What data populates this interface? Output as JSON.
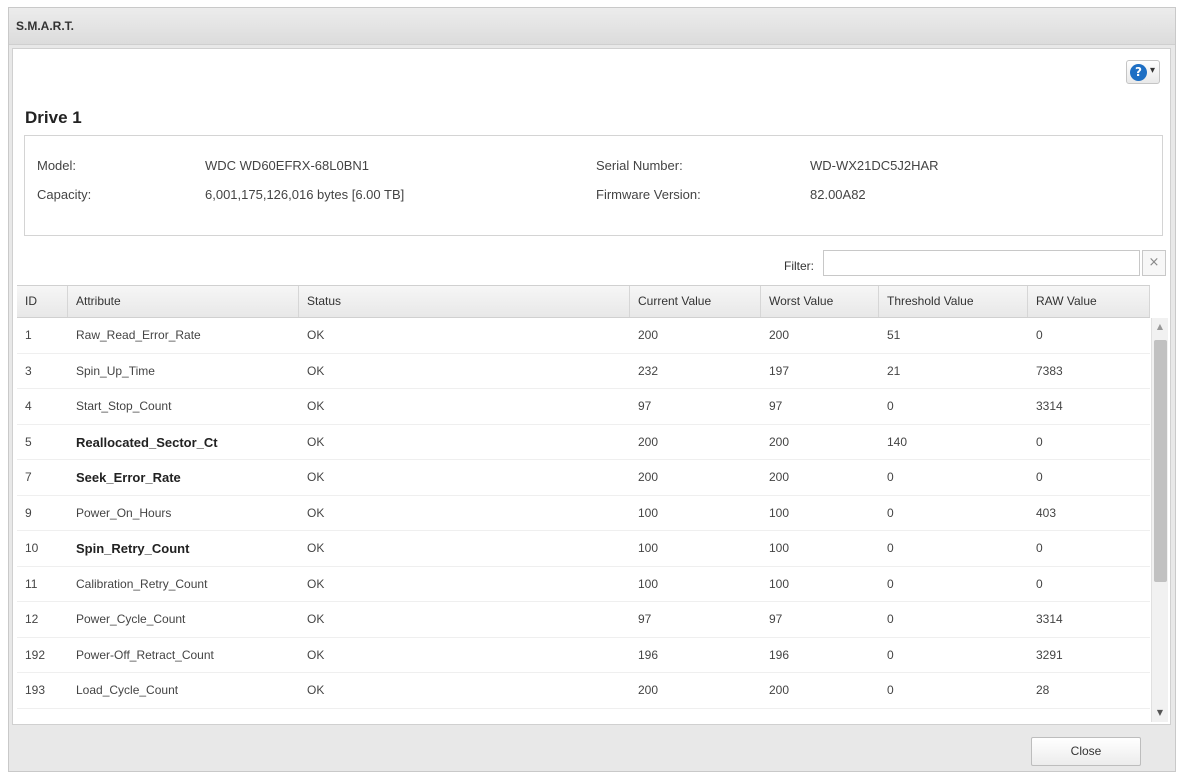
{
  "window": {
    "title": "S.M.A.R.T."
  },
  "help": {
    "icon": "help-icon",
    "glyph": "?",
    "caret": "▾"
  },
  "drive": {
    "title": "Drive 1",
    "model_label": "Model:",
    "model": "WDC WD60EFRX-68L0BN1",
    "capacity_label": "Capacity:",
    "capacity": "6,001,175,126,016 bytes [6.00 TB]",
    "serial_label": "Serial Number:",
    "serial": "WD-WX21DC5J2HAR",
    "firmware_label": "Firmware Version:",
    "firmware": "82.00A82"
  },
  "filter": {
    "label": "Filter:",
    "value": "",
    "clear_glyph": "×"
  },
  "table": {
    "headers": [
      "ID",
      "Attribute",
      "Status",
      "Current Value",
      "Worst Value",
      "Threshold Value",
      "RAW Value"
    ],
    "rows": [
      {
        "id": "1",
        "attribute": "Raw_Read_Error_Rate",
        "status": "OK",
        "current": "200",
        "worst": "200",
        "threshold": "51",
        "raw": "0",
        "bold": false
      },
      {
        "id": "3",
        "attribute": "Spin_Up_Time",
        "status": "OK",
        "current": "232",
        "worst": "197",
        "threshold": "21",
        "raw": "7383",
        "bold": false
      },
      {
        "id": "4",
        "attribute": "Start_Stop_Count",
        "status": "OK",
        "current": "97",
        "worst": "97",
        "threshold": "0",
        "raw": "3314",
        "bold": false
      },
      {
        "id": "5",
        "attribute": "Reallocated_Sector_Ct",
        "status": "OK",
        "current": "200",
        "worst": "200",
        "threshold": "140",
        "raw": "0",
        "bold": true
      },
      {
        "id": "7",
        "attribute": "Seek_Error_Rate",
        "status": "OK",
        "current": "200",
        "worst": "200",
        "threshold": "0",
        "raw": "0",
        "bold": true
      },
      {
        "id": "9",
        "attribute": "Power_On_Hours",
        "status": "OK",
        "current": "100",
        "worst": "100",
        "threshold": "0",
        "raw": "403",
        "bold": false
      },
      {
        "id": "10",
        "attribute": "Spin_Retry_Count",
        "status": "OK",
        "current": "100",
        "worst": "100",
        "threshold": "0",
        "raw": "0",
        "bold": true
      },
      {
        "id": "11",
        "attribute": "Calibration_Retry_Count",
        "status": "OK",
        "current": "100",
        "worst": "100",
        "threshold": "0",
        "raw": "0",
        "bold": false
      },
      {
        "id": "12",
        "attribute": "Power_Cycle_Count",
        "status": "OK",
        "current": "97",
        "worst": "97",
        "threshold": "0",
        "raw": "3314",
        "bold": false
      },
      {
        "id": "192",
        "attribute": "Power-Off_Retract_Count",
        "status": "OK",
        "current": "196",
        "worst": "196",
        "threshold": "0",
        "raw": "3291",
        "bold": false
      },
      {
        "id": "193",
        "attribute": "Load_Cycle_Count",
        "status": "OK",
        "current": "200",
        "worst": "200",
        "threshold": "0",
        "raw": "28",
        "bold": false
      }
    ]
  },
  "scrollbar": {
    "up_glyph": "▲",
    "down_glyph": "▼"
  },
  "footer": {
    "close_label": "Close"
  }
}
